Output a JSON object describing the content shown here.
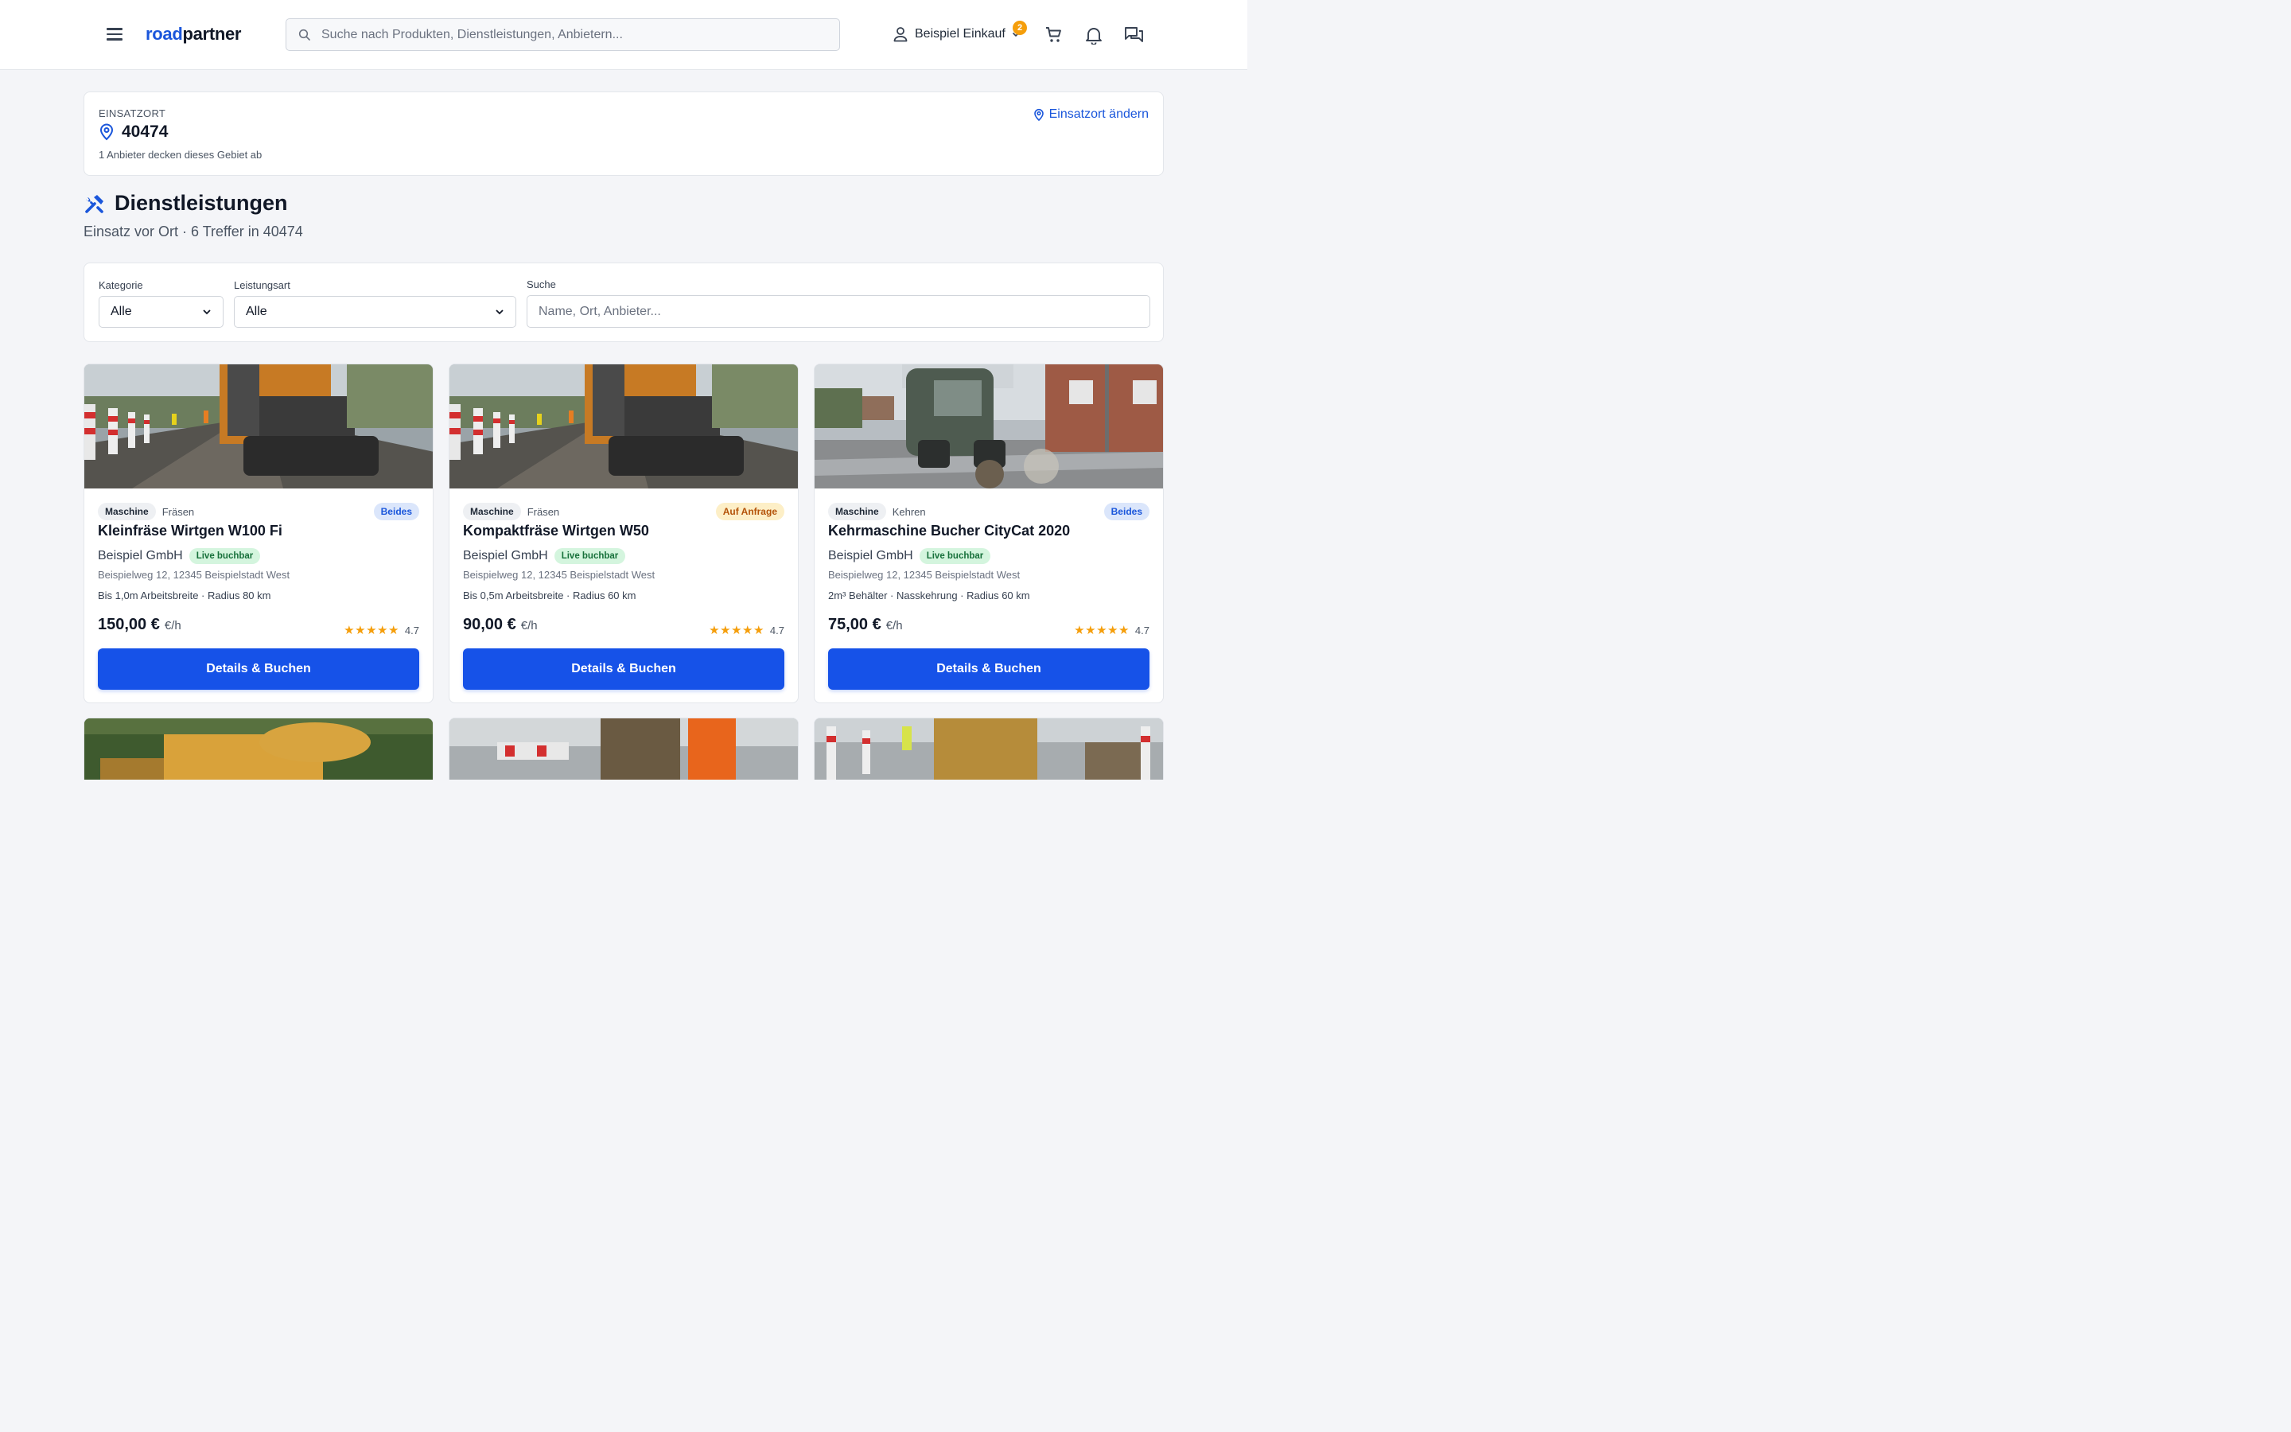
{
  "header": {
    "logo_part1": "road",
    "logo_part2": "partner",
    "search_placeholder": "Suche nach Produkten, Dienstleistungen, Anbietern...",
    "user_label": "Beispiel Einkauf",
    "badge_count": "2"
  },
  "location": {
    "label": "EINSATZORT",
    "value": "40474",
    "subtitle": "1 Anbieter decken dieses Gebiet ab",
    "change_label": "Einsatzort ändern"
  },
  "page": {
    "title": "Dienstleistungen",
    "subtitle": "Einsatz vor Ort · 6 Treffer in 40474"
  },
  "filters": {
    "category_label": "Kategorie",
    "category_value": "Alle",
    "service_type_label": "Leistungsart",
    "service_type_value": "Alle",
    "search_label": "Suche",
    "search_placeholder": "Name, Ort, Anbieter..."
  },
  "cards": [
    {
      "type": "Maschine",
      "subtype": "Fräsen",
      "mode": "Beides",
      "title": "Kleinfräse Wirtgen W100 Fi",
      "provider": "Beispiel GmbH",
      "live_label": "Live buchbar",
      "address": "Beispielweg 12, 12345 Beispielstadt West",
      "specs": "Bis 1,0m Arbeitsbreite · Radius 80 km",
      "price": "150,00 €",
      "price_unit": "€/h",
      "rating": "4.7",
      "stars": "★★★★★",
      "button": "Details & Buchen"
    },
    {
      "type": "Maschine",
      "subtype": "Fräsen",
      "mode": "Auf Anfrage",
      "title": "Kompaktfräse Wirtgen W50",
      "provider": "Beispiel GmbH",
      "live_label": "Live buchbar",
      "address": "Beispielweg 12, 12345 Beispielstadt West",
      "specs": "Bis 0,5m Arbeitsbreite · Radius 60 km",
      "price": "90,00 €",
      "price_unit": "€/h",
      "rating": "4.7",
      "stars": "★★★★★",
      "button": "Details & Buchen"
    },
    {
      "type": "Maschine",
      "subtype": "Kehren",
      "mode": "Beides",
      "title": "Kehrmaschine Bucher CityCat 2020",
      "provider": "Beispiel GmbH",
      "live_label": "Live buchbar",
      "address": "Beispielweg 12, 12345 Beispielstadt West",
      "specs": "2m³ Behälter · Nasskehrung · Radius 60 km",
      "price": "75,00 €",
      "price_unit": "€/h",
      "rating": "4.7",
      "stars": "★★★★★",
      "button": "Details & Buchen"
    }
  ],
  "colors": {
    "primary": "#1652e8",
    "brand_blue": "#1a56db",
    "star": "#f59e0b",
    "live_bg": "#d4f5de",
    "mode_blue_bg": "#dbe6fb",
    "mode_amber_bg": "#fdefc7"
  },
  "icons": [
    "menu-icon",
    "search-icon",
    "user-icon",
    "chevron-down-icon",
    "cart-icon",
    "bell-icon",
    "chat-icon",
    "location-pin-icon",
    "tools-icon"
  ]
}
